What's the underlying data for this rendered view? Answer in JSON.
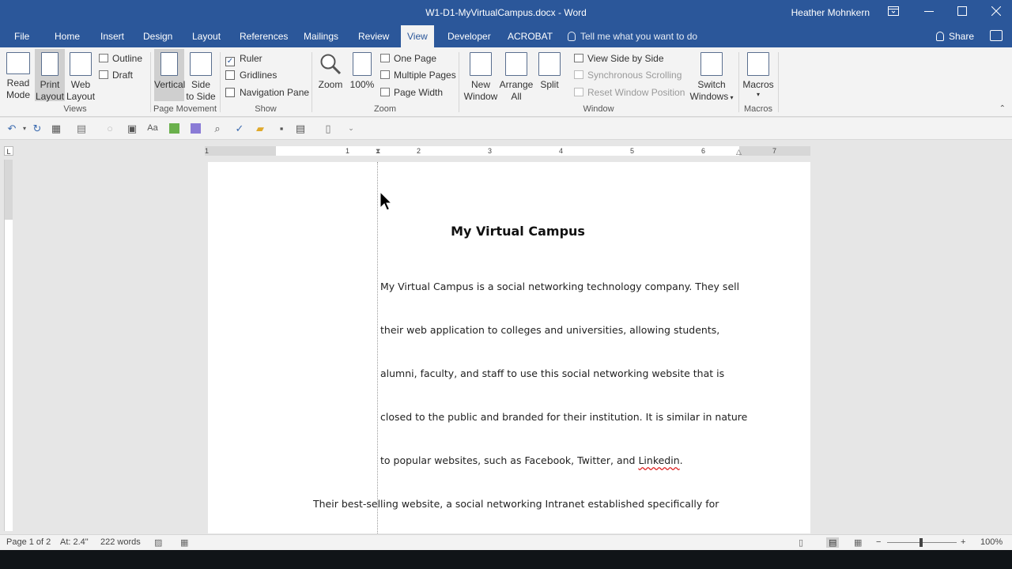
{
  "window": {
    "title": "W1-D1-MyVirtualCampus.docx - Word",
    "user": "Heather Mohnkern",
    "controls": [
      "ribbon-display",
      "minimize",
      "maximize",
      "close"
    ]
  },
  "tabs": [
    "File",
    "Home",
    "Insert",
    "Design",
    "Layout",
    "References",
    "Mailings",
    "Review",
    "View",
    "Developer",
    "ACROBAT"
  ],
  "active_tab": "View",
  "tell_me": "Tell me what you want to do",
  "share": "Share",
  "ribbon": {
    "views": {
      "read_mode": [
        "Read",
        "Mode"
      ],
      "print_layout": [
        "Print",
        "Layout"
      ],
      "web_layout": [
        "Web",
        "Layout"
      ],
      "outline": "Outline",
      "draft": "Draft",
      "group": "Views"
    },
    "page_movement": {
      "vertical": "Vertical",
      "side_to_side": [
        "Side",
        "to Side"
      ],
      "group": "Page Movement"
    },
    "show": {
      "ruler": "Ruler",
      "ruler_checked": true,
      "gridlines": "Gridlines",
      "gridlines_checked": false,
      "navigation_pane": "Navigation Pane",
      "navigation_checked": false,
      "group": "Show"
    },
    "zoom": {
      "zoom": "Zoom",
      "hundred": "100%",
      "one_page": "One Page",
      "multiple_pages": "Multiple Pages",
      "page_width": "Page Width",
      "group": "Zoom"
    },
    "window": {
      "new_window": [
        "New",
        "Window"
      ],
      "arrange_all": [
        "Arrange",
        "All"
      ],
      "split": "Split",
      "view_side_by_side": "View Side by Side",
      "sync_scrolling": "Synchronous Scrolling",
      "reset_position": "Reset Window Position",
      "switch_windows": [
        "Switch",
        "Windows"
      ],
      "group": "Window"
    },
    "macros": {
      "macros": "Macros",
      "group": "Macros"
    }
  },
  "ruler_numbers": [
    "1",
    "1",
    "2",
    "3",
    "4",
    "5",
    "6",
    "7"
  ],
  "ruler_corner": "L",
  "document": {
    "title": "My Virtual Campus",
    "lines": [
      "My Virtual Campus is a social networking technology company. They sell",
      "their web application to colleges and universities, allowing students,",
      "alumni, faculty, and staff to use this social networking website that is",
      "closed to the public and branded for their institution. It is similar in nature",
      "to popular websites, such as Facebook, Twitter, and "
    ],
    "misspelled": "Linkedin",
    "line5_end": ".",
    "outdented_line": "Their best-selling website, a social networking Intranet established specifically for"
  },
  "status": {
    "page": "Page 1 of 2",
    "at": "At: 2.4\"",
    "words": "222 words",
    "zoom": "100%"
  },
  "colors": {
    "title_bar": "#2b579a",
    "ribbon": "#f3f3f3",
    "workspace": "#e6e6e6"
  }
}
